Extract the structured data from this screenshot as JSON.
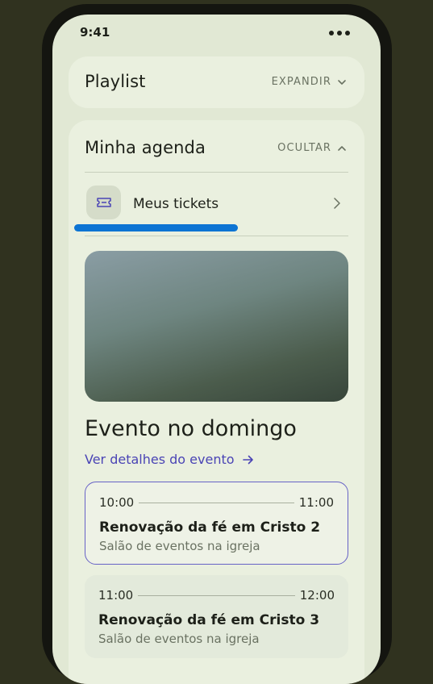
{
  "status_bar": {
    "time": "9:41"
  },
  "playlist": {
    "title": "Playlist",
    "action": "EXPANDIR",
    "action_icon": "chevron-down-icon"
  },
  "agenda": {
    "title": "Minha agenda",
    "action": "OCULTAR",
    "action_icon": "chevron-up-icon",
    "tickets": {
      "label": "Meus tickets",
      "icon": "ticket-icon",
      "chevron_icon": "chevron-right-icon"
    },
    "highlight_color": "#0d74d3",
    "event": {
      "title": "Evento no domingo",
      "link_label": "Ver detalhes do evento",
      "link_icon": "arrow-right-icon",
      "link_color": "#4a44b5"
    },
    "sessions": [
      {
        "start": "10:00",
        "end": "11:00",
        "title": "Renovação da fé em Cristo 2",
        "place": "Salão de eventos na igreja",
        "selected": true
      },
      {
        "start": "11:00",
        "end": "12:00",
        "title": "Renovação da fé em Cristo 3",
        "place": "Salão de eventos na igreja",
        "selected": false
      }
    ]
  }
}
